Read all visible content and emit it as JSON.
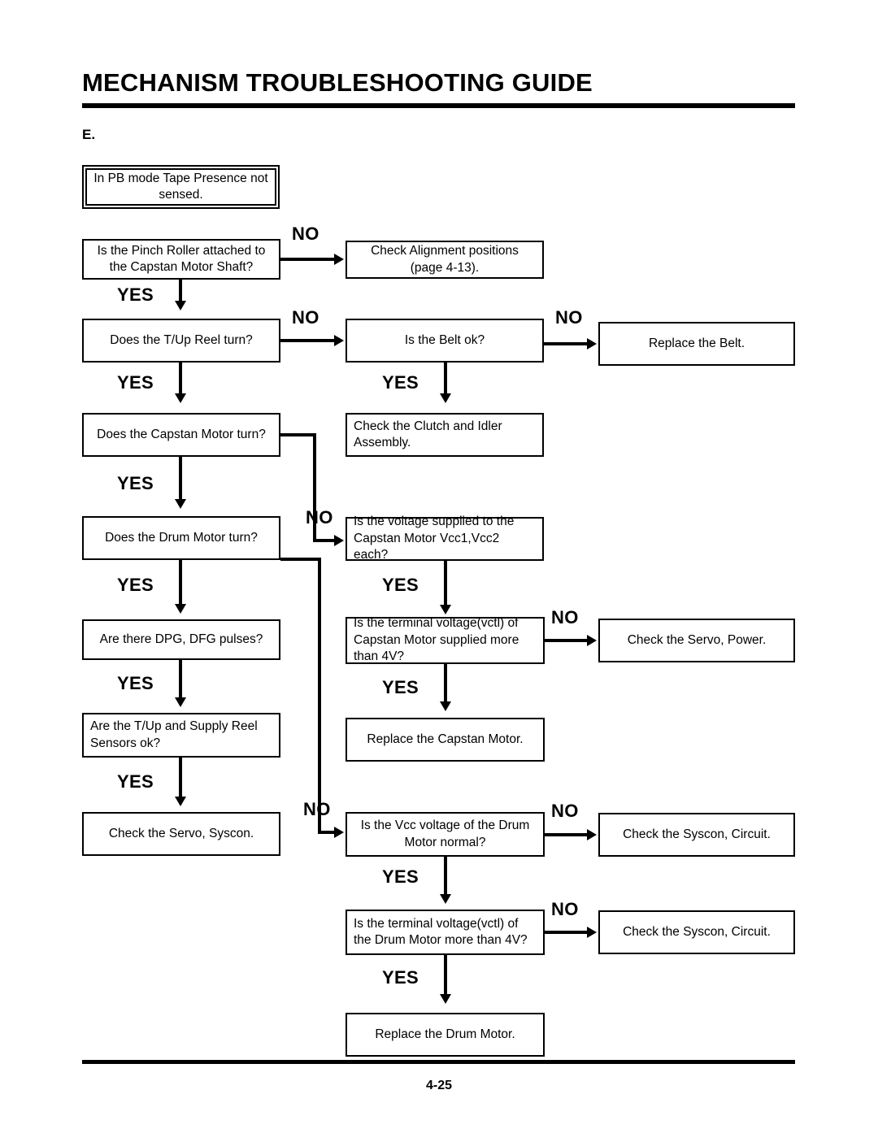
{
  "document": {
    "title": "MECHANISM TROUBLESHOOTING GUIDE",
    "section_letter": "E.",
    "page_number": "4-25"
  },
  "labels": {
    "yes": "YES",
    "no": "NO"
  },
  "flow": {
    "start": "In PB mode Tape Presence not sensed.",
    "nodes": {
      "pinch_roller": "Is the Pinch Roller attached to the Capstan Motor Shaft?",
      "check_alignment": "Check Alignment positions (page 4-13).",
      "tup_reel": "Does the T/Up Reel turn?",
      "belt_ok": "Is the Belt ok?",
      "replace_belt": "Replace the Belt.",
      "check_clutch_idler": "Check the Clutch and Idler Assembly.",
      "capstan_motor_turn": "Does the Capstan Motor turn?",
      "drum_motor_turn": "Does the Drum Motor turn?",
      "capstan_vcc": "Is the voltage supplied to the Capstan Motor Vcc1,Vcc2 each?",
      "capstan_vctl": "Is the terminal voltage(vctl) of Capstan Motor supplied more than 4V?",
      "check_servo_power": "Check the Servo, Power.",
      "replace_capstan_motor": "Replace the Capstan Motor.",
      "dpg_dfg": "Are there DPG, DFG pulses?",
      "reel_sensors": "Are the T/Up and Supply Reel Sensors ok?",
      "check_servo_syscon": "Check the Servo, Syscon.",
      "drum_vcc": "Is the Vcc voltage of the Drum Motor normal?",
      "check_syscon_circuit_1": "Check the Syscon, Circuit.",
      "drum_vctl": "Is the terminal voltage(vctl) of the Drum Motor more than 4V?",
      "check_syscon_circuit_2": "Check the Syscon, Circuit.",
      "replace_drum_motor": "Replace the Drum Motor."
    }
  },
  "theme": {
    "ink": "#000000",
    "paper": "#ffffff"
  }
}
